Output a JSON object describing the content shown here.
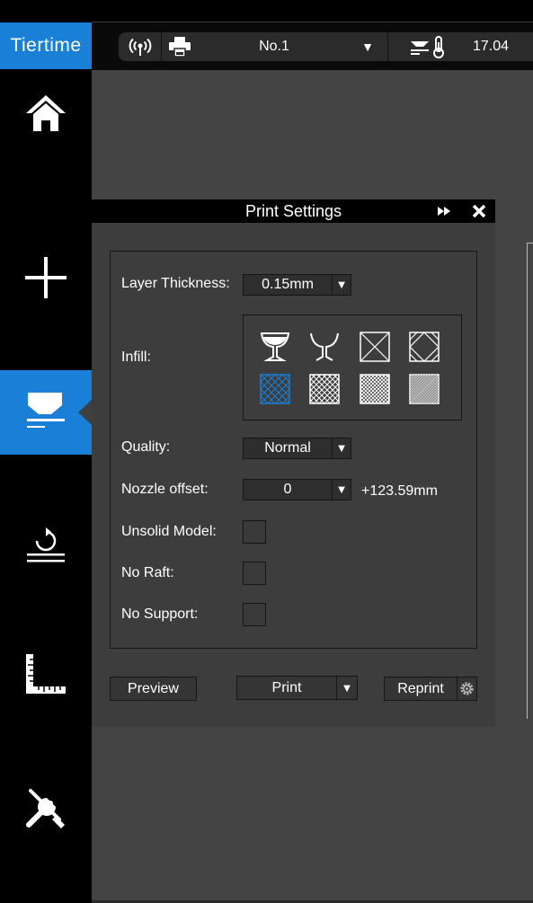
{
  "app": {
    "logo_text": "Tiertime"
  },
  "header": {
    "wifi_icon": "wifi-broadcast-icon",
    "printer_icon": "printer-icon",
    "printer_name": "No.1",
    "printer_dropdown_caret": "▼",
    "temperature_icon": "platform-thermometer-icon",
    "temperature_value": "17.04"
  },
  "sidebar": {
    "items": [
      {
        "name": "home",
        "icon": "home-icon"
      },
      {
        "name": "add",
        "icon": "plus-icon"
      },
      {
        "name": "print",
        "icon": "print-platform-icon",
        "active": true
      },
      {
        "name": "calibrate",
        "icon": "rotate-platform-icon"
      },
      {
        "name": "measure",
        "icon": "ruler-icon"
      },
      {
        "name": "maintenance",
        "icon": "tools-icon"
      }
    ],
    "accent_color": "#1a7fd6"
  },
  "dialog": {
    "title": "Print Settings",
    "forward_icon": "fast-forward-icon",
    "close_icon": "close-icon",
    "layer_thickness": {
      "label": "Layer Thickness:",
      "value": "0.15mm",
      "caret": "▼"
    },
    "infill": {
      "label": "Infill:",
      "options": [
        {
          "name": "shell-cup",
          "icon": "shell-infill-icon"
        },
        {
          "name": "surface-cup",
          "icon": "surface-infill-icon"
        },
        {
          "name": "sparse-x",
          "icon": "large-hollow-infill-icon"
        },
        {
          "name": "sparse-diamond",
          "icon": "hollow-infill-icon"
        },
        {
          "name": "grid-selected",
          "icon": "loose-infill-icon",
          "selected": true
        },
        {
          "name": "grid-medium",
          "icon": "medium-infill-icon"
        },
        {
          "name": "grid-dense",
          "icon": "dense-infill-icon"
        },
        {
          "name": "solid",
          "icon": "solid-infill-icon"
        }
      ]
    },
    "quality": {
      "label": "Quality:",
      "value": "Normal",
      "caret": "▼"
    },
    "nozzle_offset": {
      "label": "Nozzle offset:",
      "value": "0",
      "caret": "▼",
      "extra": "+123.59mm"
    },
    "unsolid_model": {
      "label": "Unsolid Model:",
      "checked": false
    },
    "no_raft": {
      "label": "No Raft:",
      "checked": false
    },
    "no_support": {
      "label": "No Support:",
      "checked": false
    },
    "buttons": {
      "preview": "Preview",
      "print": "Print",
      "print_caret": "▼",
      "reprint": "Reprint",
      "reprint_settings_icon": "gear-icon"
    }
  }
}
